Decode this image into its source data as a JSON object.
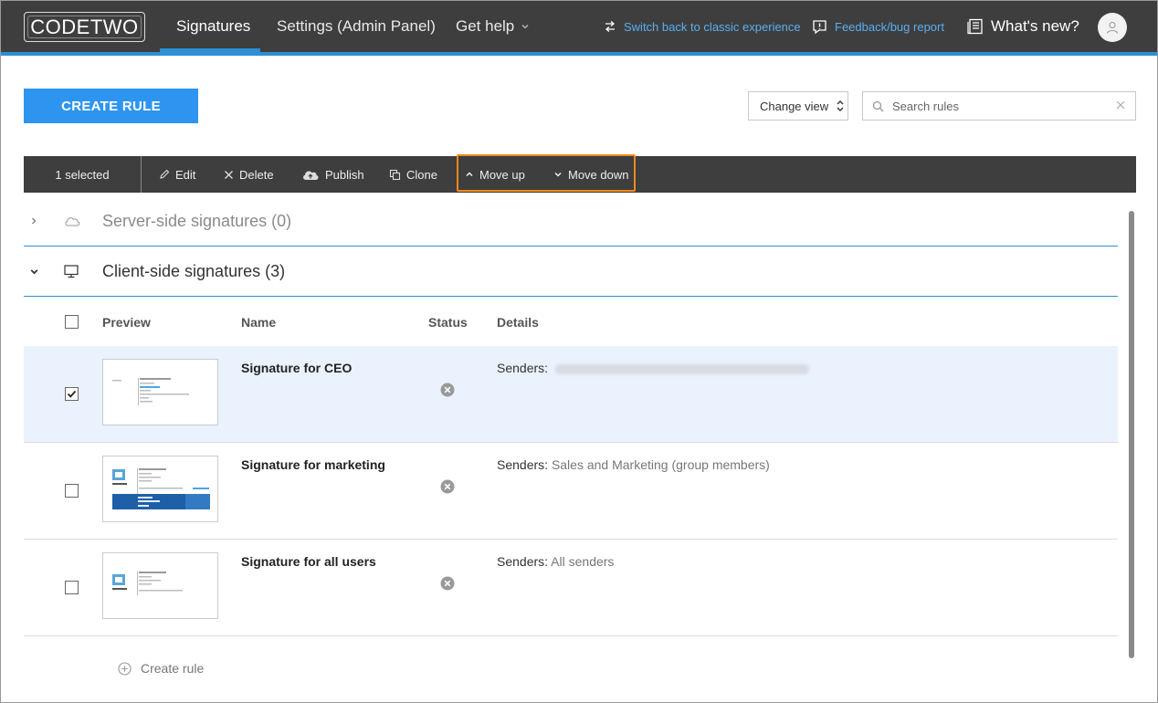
{
  "nav": {
    "logo": "CODETWO",
    "items": [
      "Signatures",
      "Settings (Admin Panel)",
      "Get help"
    ],
    "switch_link": "Switch back to classic experience",
    "feedback_link": "Feedback/bug report",
    "whats_new": "What's new?"
  },
  "toolbar": {
    "create_rule": "CREATE RULE",
    "change_view": "Change view",
    "search_placeholder": "Search rules"
  },
  "actionbar": {
    "selected": "1 selected",
    "edit": "Edit",
    "delete": "Delete",
    "publish": "Publish",
    "clone": "Clone",
    "move_up": "Move up",
    "move_down": "Move down"
  },
  "groups": {
    "server": "Server-side signatures (0)",
    "client": "Client-side signatures (3)"
  },
  "table": {
    "headers": {
      "preview": "Preview",
      "name": "Name",
      "status": "Status",
      "details": "Details"
    },
    "rows": [
      {
        "name": "Signature for CEO",
        "details_label": "Senders:",
        "details_value": "",
        "checked": true
      },
      {
        "name": "Signature for marketing",
        "details_label": "Senders:",
        "details_value": "Sales and Marketing (group members)",
        "checked": false
      },
      {
        "name": "Signature for all users",
        "details_label": "Senders:",
        "details_value": "All senders",
        "checked": false
      }
    ]
  },
  "footer": {
    "create_rule": "Create rule"
  },
  "colors": {
    "topbar": "#3e3e3e",
    "accent": "#2d8fd5",
    "button": "#2d95f0",
    "highlight": "#f08a1c",
    "selected_row": "#eaf2fd"
  }
}
